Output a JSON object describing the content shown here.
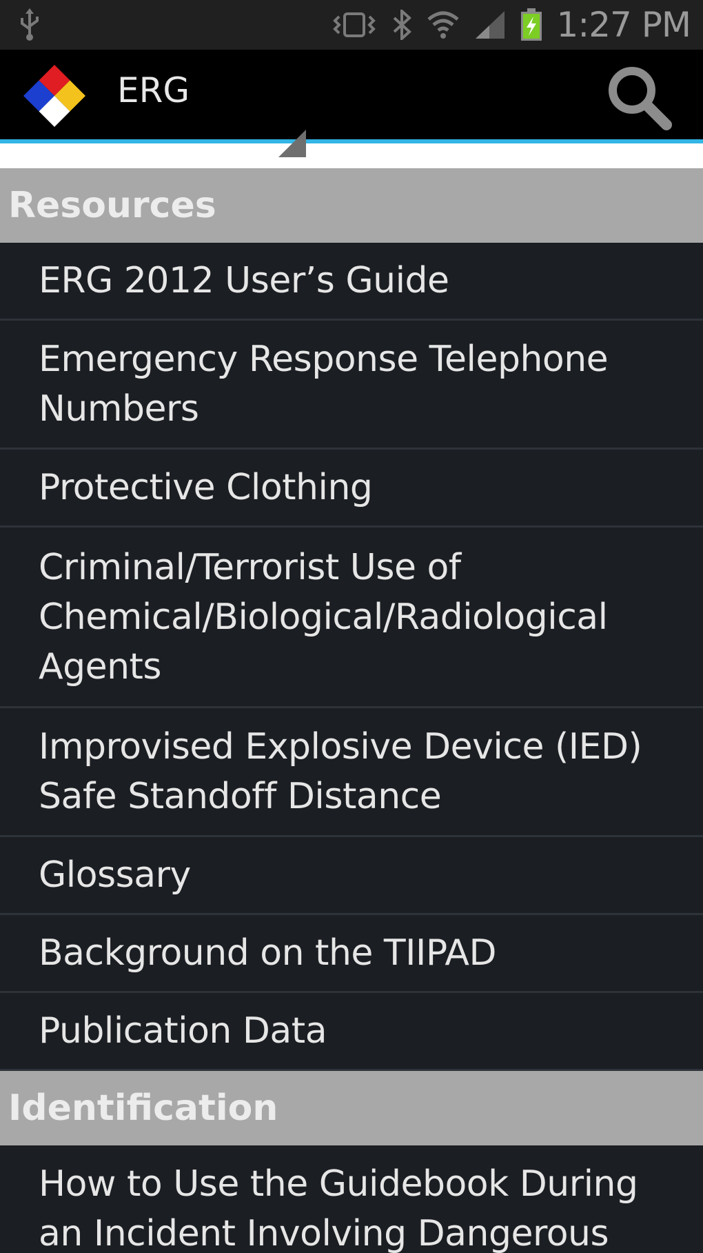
{
  "status_bar": {
    "time": "1:27 PM",
    "icons": [
      "usb-icon",
      "vibrate-icon",
      "bluetooth-icon",
      "wifi-icon",
      "signal-icon",
      "battery-charging-icon"
    ]
  },
  "action_bar": {
    "title": "ERG",
    "logo": "hazard-diamond-icon",
    "search_icon": "search-icon"
  },
  "sections": [
    {
      "header": "Resources",
      "items": [
        "ERG 2012 User’s Guide",
        "Emergency Response Telephone\nNumbers",
        "Protective Clothing",
        "Criminal/Terrorist Use of\nChemical/Biological/Radiological\nAgents",
        "Improvised Explosive Device (IED)\nSafe Standoff Distance",
        "Glossary",
        "Background on the TIIPAD",
        "Publication Data"
      ]
    },
    {
      "header": "Identification",
      "items": [
        "How to Use the Guidebook During\nan Incident Involving Dangerous"
      ]
    }
  ],
  "colors": {
    "accent": "#33b5e5",
    "header_bg": "#a8a8a8",
    "list_bg": "#1b1e22"
  }
}
